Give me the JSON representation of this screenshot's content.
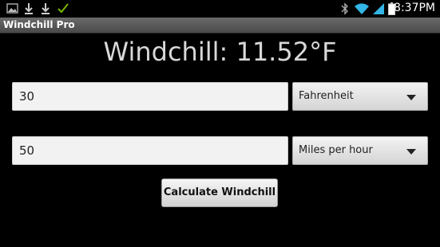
{
  "status_bar": {
    "time": "8:37PM",
    "left_icons": [
      "image-icon",
      "download-icon",
      "download-icon",
      "check-icon"
    ],
    "right_icons": [
      "bluetooth-icon",
      "wifi-icon",
      "signal-icon",
      "battery-icon"
    ]
  },
  "app": {
    "title": "Windchill Pro"
  },
  "result": {
    "text": "Windchill: 11.52°F"
  },
  "temperature": {
    "value": "30",
    "unit_selected": "Fahrenheit"
  },
  "wind": {
    "value": "50",
    "unit_selected": "Miles per hour"
  },
  "actions": {
    "calculate_label": "Calculate Windchill"
  },
  "colors": {
    "background": "#000000",
    "result_text": "#d8d8d8",
    "accent_check": "#7ab800"
  }
}
